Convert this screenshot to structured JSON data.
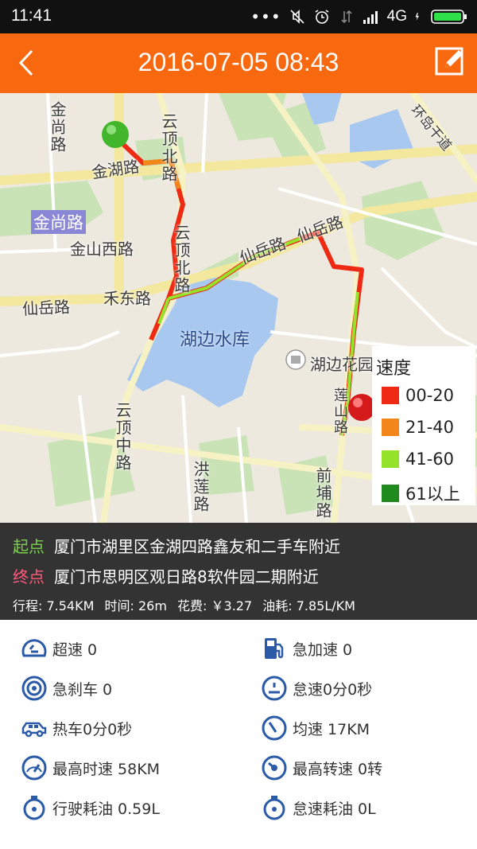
{
  "status_bar": {
    "time": "11:41",
    "network": "4G"
  },
  "header": {
    "title": "2016-07-05 08:43"
  },
  "map": {
    "labels": {
      "jinshang_road_vert": "金尚路",
      "jinhu_road": "金湖路",
      "yunding_north_road_upper": "云顶北路",
      "jinshang_road_badge": "金尚路",
      "jinshan_west_road": "金山西路",
      "yunding_north_road_lower": "云顶北路",
      "hedong_road": "禾东路",
      "xianyue_road_left": "仙岳路",
      "xianyue_road_mid": "仙岳路",
      "xianyue_road_right": "仙岳路",
      "hubian_reservoir": "湖边水库",
      "hubian_garden": "湖边花园",
      "yunding_middle_road": "云顶中路",
      "honglian_road": "洪莲路",
      "qianpu_road": "前埔路",
      "fu_road": "莲山路",
      "huandao_road": "环岛干道"
    },
    "legend": {
      "title": "速度",
      "items": [
        {
          "label": "00-20",
          "color": "#ee2a14"
        },
        {
          "label": "21-40",
          "color": "#f2861a"
        },
        {
          "label": "41-60",
          "color": "#95e22a"
        },
        {
          "label": "61以上",
          "color": "#1f8b1f"
        }
      ]
    }
  },
  "trip": {
    "start_tag": "起点",
    "start_address": "厦门市湖里区金湖四路鑫友和二手车附近",
    "end_tag": "终点",
    "end_address": "厦门市思明区观日路8软件园二期附近",
    "distance": "行程: 7.54KM",
    "duration": "时间: 26m",
    "cost": "花费: ￥3.27",
    "fuel_rate": "油耗: 7.85L/KM"
  },
  "stats": {
    "overspeed": "超速 0",
    "rapid_accel": "急加速 0",
    "hard_brake": "急刹车 0",
    "idle_time": "怠速0分0秒",
    "warmup": "热车0分0秒",
    "avg_speed": "均速 17KM",
    "max_speed": "最高时速 58KM",
    "max_rpm": "最高转速 0转",
    "drive_fuel": "行驶耗油 0.59L",
    "idle_fuel": "怠速耗油 0L"
  },
  "colors": {
    "header": "#f7680f",
    "icon_blue": "#2a5aa8",
    "start": "#7bd24a",
    "end": "#ff5a7a"
  }
}
